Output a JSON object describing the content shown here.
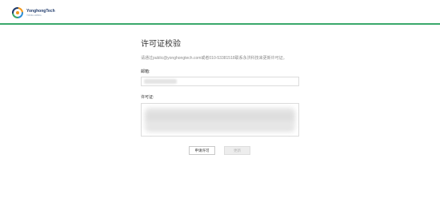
{
  "header": {
    "brand_name": "YonghongTech",
    "brand_sub": "YONG HONG"
  },
  "page": {
    "title": "许可证校验",
    "hint": "请通过public@yonghongtech.com或者010-53381518联系永洪科技来更新许可证。"
  },
  "form": {
    "email_label": "邮箱:",
    "email_value": "",
    "license_label": "许可证:",
    "license_value": ""
  },
  "buttons": {
    "apply_label": "申请许可",
    "update_label": "更新"
  },
  "colors": {
    "accent": "#3aa86b",
    "disabled_bg": "#ededed"
  }
}
